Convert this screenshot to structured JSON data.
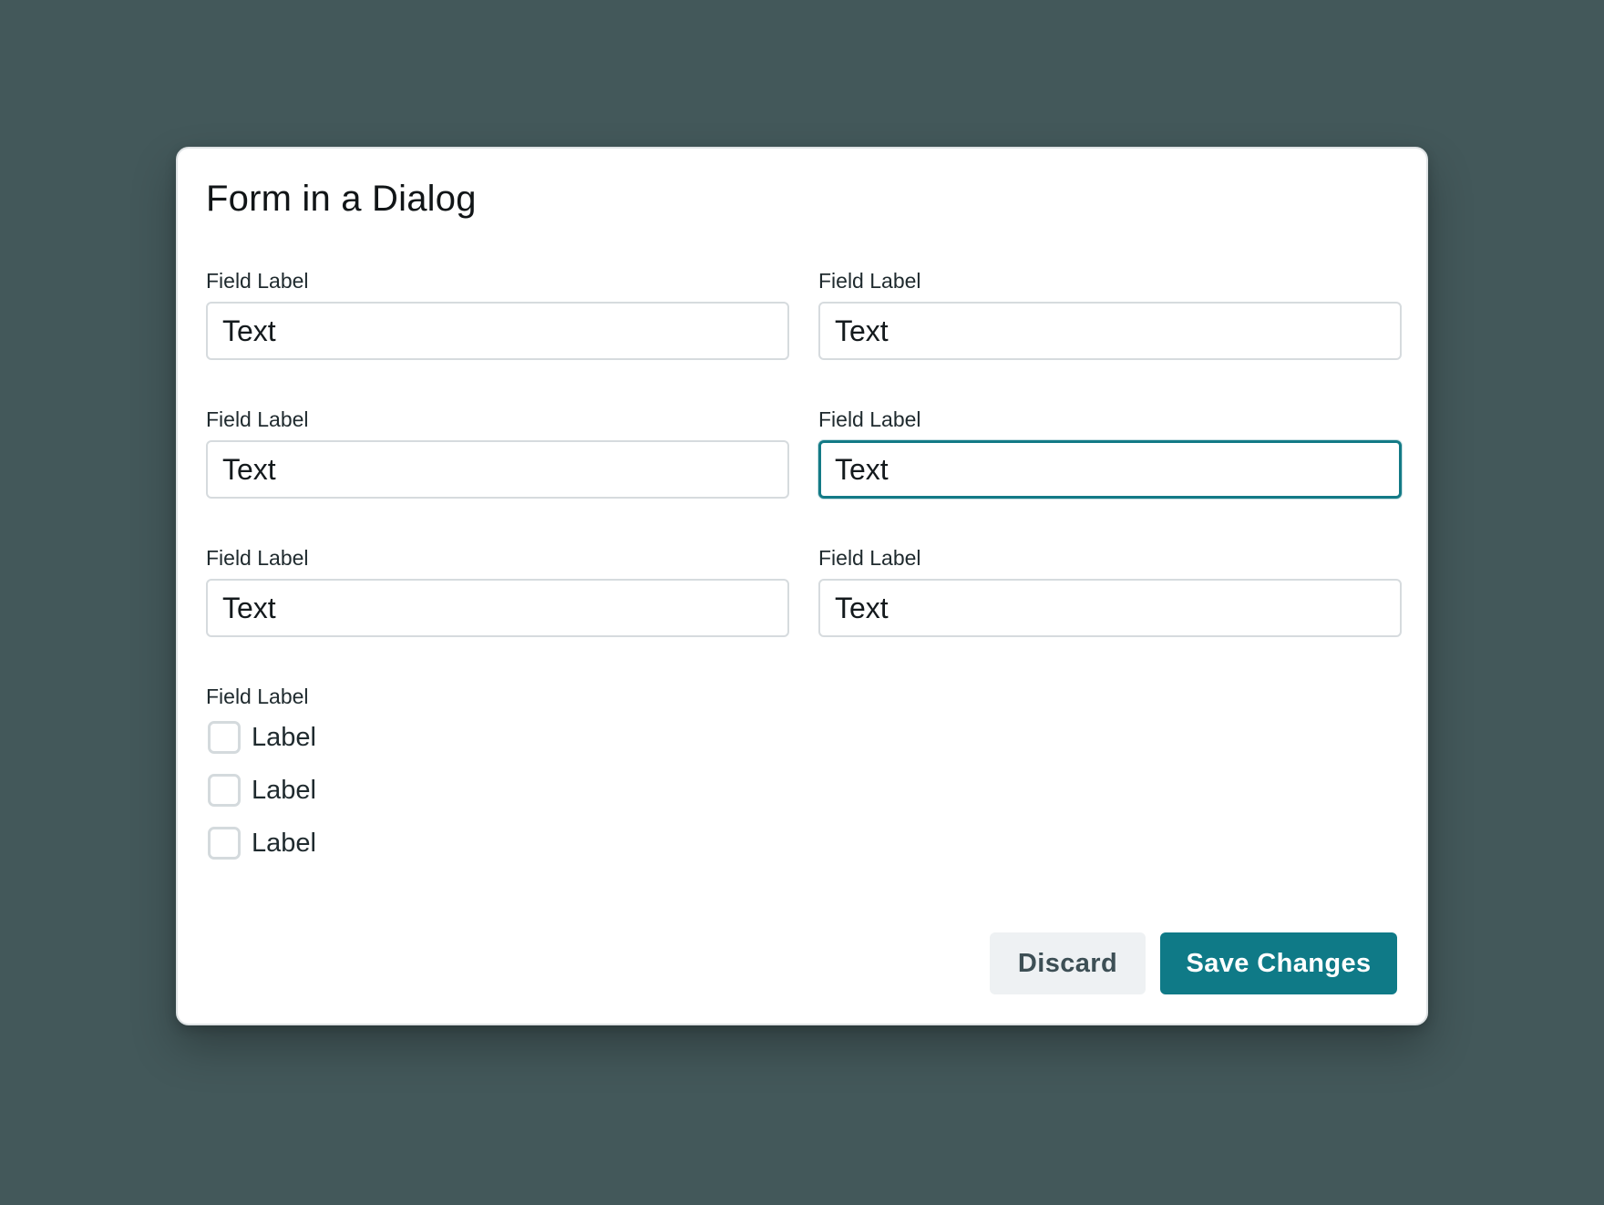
{
  "dialog": {
    "title": "Form in a Dialog",
    "fields": [
      {
        "label": "Field Label",
        "value": "Text"
      },
      {
        "label": "Field Label",
        "value": "Text"
      },
      {
        "label": "Field Label",
        "value": "Text"
      },
      {
        "label": "Field Label",
        "value": "Text",
        "focused": true
      },
      {
        "label": "Field Label",
        "value": "Text"
      },
      {
        "label": "Field Label",
        "value": "Text"
      }
    ],
    "checkbox_group": {
      "label": "Field Label",
      "options": [
        {
          "label": "Label",
          "checked": false
        },
        {
          "label": "Label",
          "checked": false
        },
        {
          "label": "Label",
          "checked": false
        }
      ]
    },
    "actions": {
      "discard_label": "Discard",
      "save_label": "Save Changes"
    }
  },
  "colors": {
    "backdrop": "#43585a",
    "accent": "#0f7a87",
    "focus_border": "#137a86",
    "secondary_button_bg": "#eef1f3"
  }
}
